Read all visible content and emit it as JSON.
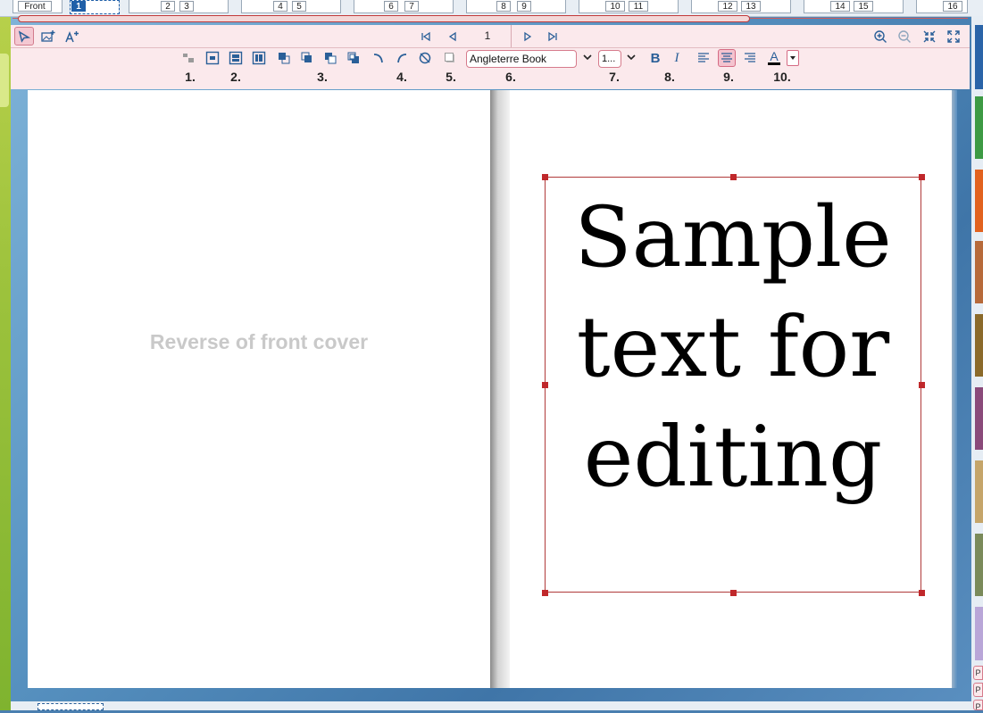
{
  "page_strip": {
    "front_label": "Front",
    "active_page": "1",
    "pages": [
      "2",
      "3",
      "4",
      "5",
      "6",
      "7",
      "8",
      "9",
      "10",
      "11",
      "12",
      "13",
      "14",
      "15",
      "16"
    ]
  },
  "nav_toolbar": {
    "tools": [
      "select-tool-icon",
      "add-image-icon",
      "add-text-icon"
    ],
    "page_value": "1",
    "nav": [
      "first-page-icon",
      "previous-page-icon",
      "next-page-icon",
      "last-page-icon"
    ],
    "zoom": [
      "zoom-in-icon",
      "zoom-out-icon",
      "fit-page-icon",
      "fullscreen-icon"
    ]
  },
  "format_toolbar": {
    "group_labels": [
      "1.",
      "2.",
      "3.",
      "4.",
      "5.",
      "6.",
      "7.",
      "8.",
      "9.",
      "10."
    ],
    "font_name": "Angleterre Book",
    "font_size": "1...",
    "bold_label": "B",
    "italic_label": "I",
    "color_label": "A",
    "accent_color": "#d56b84"
  },
  "spread": {
    "left_page_text": "Reverse of front cover",
    "sample_text_lines": [
      "Sample",
      "text for",
      "editing"
    ]
  },
  "right_rail": {
    "tab_labels": [
      "P",
      "P",
      "P"
    ]
  }
}
